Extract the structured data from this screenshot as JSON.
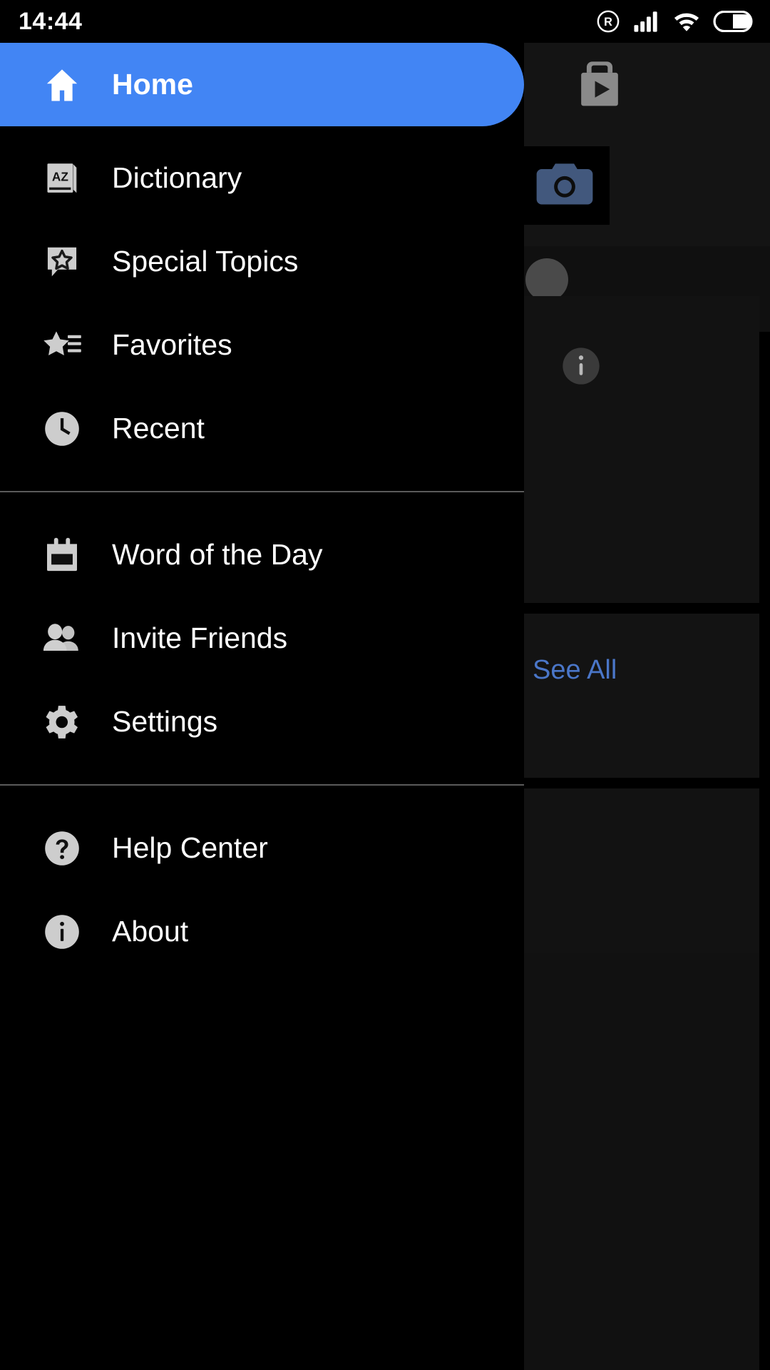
{
  "status_bar": {
    "time": "14:44",
    "icons": [
      {
        "name": "roaming-icon",
        "glyph": "R"
      },
      {
        "name": "cellular-signal-icon",
        "glyph": "signal"
      },
      {
        "name": "wifi-icon",
        "glyph": "wifi"
      },
      {
        "name": "battery-icon",
        "glyph": "battery"
      }
    ]
  },
  "drawer": {
    "accent_color": "#4285F4",
    "background_color": "#000000",
    "icon_color": "#cccccc",
    "text_color": "#ffffff",
    "divider_color": "#5a5a5a",
    "sections": [
      {
        "items": [
          {
            "label": "Home",
            "icon": "home-icon",
            "selected": true
          },
          {
            "label": "Dictionary",
            "icon": "dictionary-book-icon",
            "selected": false
          },
          {
            "label": "Special Topics",
            "icon": "star-bubble-icon",
            "selected": false
          },
          {
            "label": "Favorites",
            "icon": "star-list-icon",
            "selected": false
          },
          {
            "label": "Recent",
            "icon": "clock-icon",
            "selected": false
          }
        ]
      },
      {
        "items": [
          {
            "label": "Word of the Day",
            "icon": "calendar-icon",
            "selected": false
          },
          {
            "label": "Invite Friends",
            "icon": "people-icon",
            "selected": false
          },
          {
            "label": "Settings",
            "icon": "gear-icon",
            "selected": false
          }
        ]
      },
      {
        "items": [
          {
            "label": "Help Center",
            "icon": "help-circle-icon",
            "selected": false
          },
          {
            "label": "About",
            "icon": "info-circle-icon",
            "selected": false
          }
        ]
      }
    ]
  },
  "background_app": {
    "see_all_label": "See All",
    "see_all_color": "#4a76c8",
    "icons": [
      {
        "name": "play-store-bag-icon"
      },
      {
        "name": "camera-icon"
      },
      {
        "name": "avatar-circle-icon"
      },
      {
        "name": "info-circle-icon"
      }
    ]
  }
}
